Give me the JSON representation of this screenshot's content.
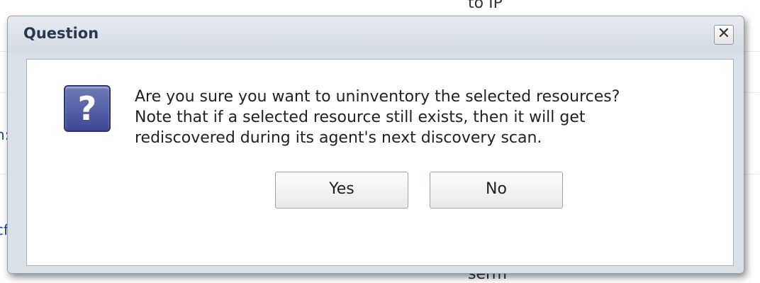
{
  "background": {
    "top_text": "to IP",
    "left_text_1": "n:",
    "left_text_2": "cf",
    "bottom_text": "serm"
  },
  "dialog": {
    "title": "Question",
    "close_glyph": "✕",
    "icon": "question-icon",
    "icon_glyph": "?",
    "message_lines": [
      "Are you sure you want to uninventory the selected resources?",
      "Note that if a selected resource still exists, then it will get",
      "rediscovered during its agent's next discovery scan."
    ],
    "yes_label": "Yes",
    "no_label": "No"
  },
  "colors": {
    "title": "#283a52",
    "icon_bg": "#4a55a2",
    "frame": "#d9e0e8"
  }
}
